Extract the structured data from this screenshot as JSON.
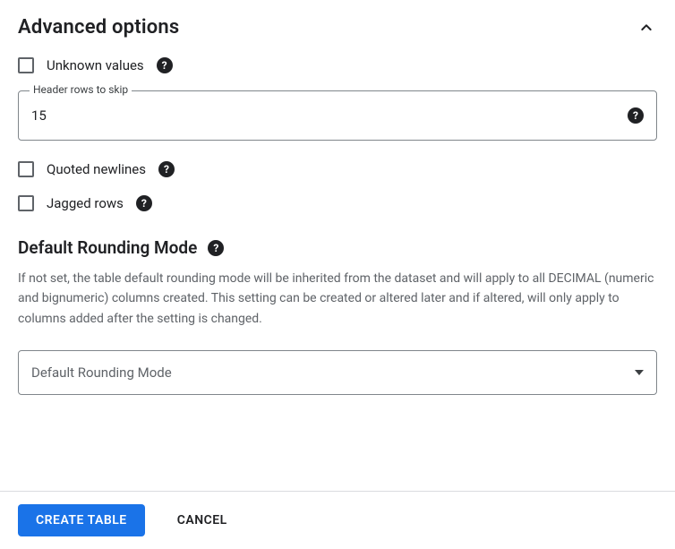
{
  "header": {
    "title": "Advanced options"
  },
  "checkboxes": {
    "unknown_values": {
      "label": "Unknown values"
    },
    "quoted_newlines": {
      "label": "Quoted newlines"
    },
    "jagged_rows": {
      "label": "Jagged rows"
    }
  },
  "header_rows": {
    "label": "Header rows to skip",
    "value": "15"
  },
  "rounding": {
    "title": "Default Rounding Mode",
    "description": "If not set, the table default rounding mode will be inherited from the dataset and will apply to all DECIMAL (numeric and bignumeric) columns created. This setting can be created or altered later and if altered, will only apply to columns added after the setting is changed.",
    "selected": "Default Rounding Mode"
  },
  "footer": {
    "create": "CREATE TABLE",
    "cancel": "CANCEL"
  }
}
